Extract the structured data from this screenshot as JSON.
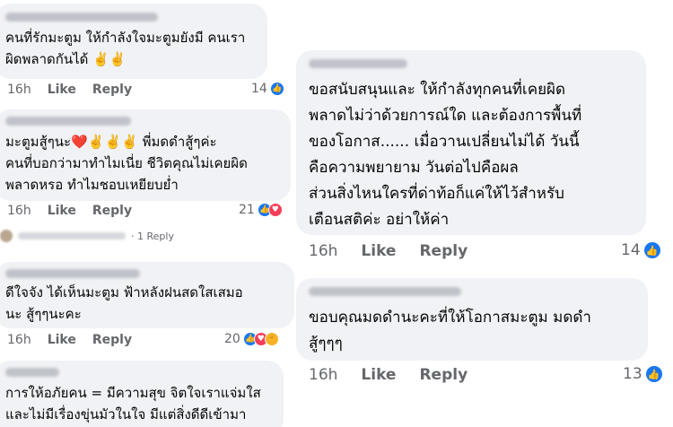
{
  "left": [
    {
      "text": "คนที่รักมะตูม ให้กำลังใจมะตูมยังมี คนเรา\nผิดพลาดกันได้ ✌️✌️",
      "time": "16h",
      "like": "Like",
      "reply": "Reply",
      "count": "14",
      "reactions": [
        "like-icon"
      ]
    },
    {
      "text": "มะตูมสู้ๆนะ❤️✌️✌️✌️ พี่มดดำสู้ๆค่ะ\nคนที่บอกว่ามาทำไมเนี่ย ชีวิตคุณไม่เคยผิด\nพลาดหรอ ทำไมชอบเหยียบย่ำ",
      "time": "16h",
      "like": "Like",
      "reply": "Reply",
      "count": "21",
      "reactions": [
        "like-icon",
        "heart-icon"
      ]
    },
    {
      "text": "ดีใจจัง ได้เห็นมะตูม ฟ้าหลังฝนสดใสเสมอ\nนะ สู้ๆๆนะคะ",
      "time": "16h",
      "like": "Like",
      "reply": "Reply",
      "count": "20",
      "reactions": [
        "like-icon",
        "heart-icon",
        "haha-icon"
      ]
    },
    {
      "text": "การให้อภัยคน = มีความสุข จิตใจเราแจ่มใส\nและไม่มีเรื่องขุ่นมัวในใจ มีแต่สิ่งดีดีเข้ามา"
    }
  ],
  "reply_link": "· 1 Reply",
  "right": [
    {
      "text": "ขอสนับสนุนและ ให้กำลังทุกคนที่เคยผิด\nพลาดไม่ว่าด้วยการณ์ใด และต้องการพื้นที่\nของโอกาส...... เมื่อวานเปลี่ยนไม่ได้  วันนี้\nคือความพยายาม วันต่อไปคือผล\nส่วนสิ่งไหนใครที่ด่าท้อก็แค่ให้ไว้สำหรับ\nเตือนสติค่ะ  อย่าให้ค่า",
      "time": "16h",
      "like": "Like",
      "reply": "Reply",
      "count": "14",
      "reactions": [
        "like-icon"
      ]
    },
    {
      "text": "ขอบคุณมดดำนะคะที่ให้โอกาสมะตูม มดดำ\nสู้ๆๆๆ",
      "time": "16h",
      "like": "Like",
      "reply": "Reply",
      "count": "13",
      "reactions": [
        "like-icon"
      ]
    }
  ],
  "colors": {
    "bubble": "#f0f2f5",
    "meta": "#65676b",
    "like": "#1877f2",
    "heart": "#f33e58",
    "haha": "#f7b125"
  }
}
